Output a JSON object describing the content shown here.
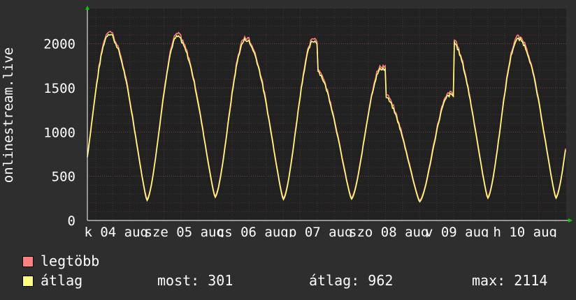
{
  "chart_data": {
    "type": "line",
    "ylabel": "onlinestream.live",
    "ylim": [
      0,
      2400
    ],
    "yticks": [
      0,
      500,
      1000,
      1500,
      2000
    ],
    "xticks": [
      "k 04 aug",
      "sze 05 aug",
      "cs 06 aug",
      "p 07 aug",
      "szo 08 aug",
      "v 09 aug",
      "h 10 aug"
    ],
    "grid": true,
    "colors": {
      "background": "#2e2e2e",
      "plot": "#212121",
      "grid": "#5a3a3a",
      "max_line": "#ff7f7f",
      "avg_line": "#ffff80"
    },
    "series": [
      {
        "name": "legtöbb"
      },
      {
        "name": "átlag"
      }
    ],
    "days": [
      {
        "peak": 2114,
        "trough": 230
      },
      {
        "peak": 2080,
        "trough": 225
      },
      {
        "peak": 2045,
        "trough": 260
      },
      {
        "peak": 2030,
        "trough": 235
      },
      {
        "peak": 1720,
        "trough": 240
      },
      {
        "peak": 1420,
        "trough": 210
      },
      {
        "peak": 2050,
        "trough": 250
      }
    ]
  },
  "legend": {
    "max_label": "legtöbb",
    "avg_label": "átlag",
    "most": "most: 301",
    "atlag": "átlag: 962",
    "max": "max: 2114"
  }
}
